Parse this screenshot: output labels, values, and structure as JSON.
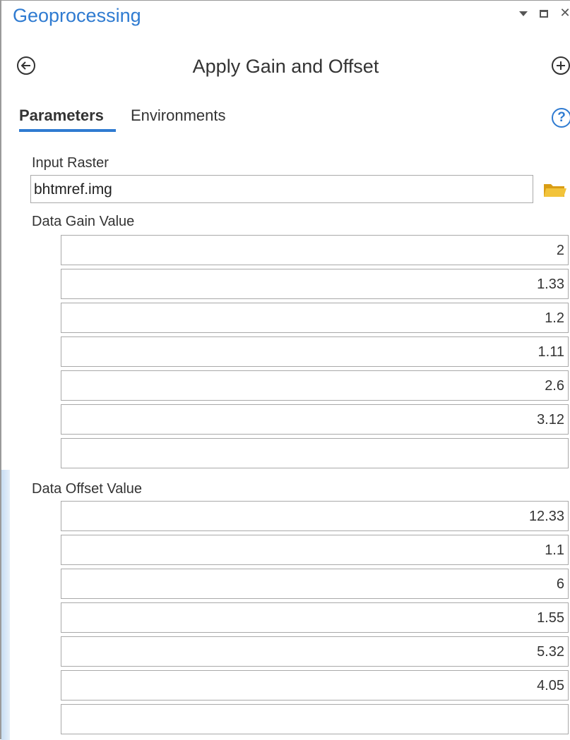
{
  "window": {
    "title": "Geoprocessing",
    "pin_icon": "dropdown-triangle-icon",
    "max_icon": "maximize-icon",
    "close_glyph": "✕"
  },
  "tool": {
    "title": "Apply Gain and Offset"
  },
  "tabs": [
    {
      "label": "Parameters",
      "active": true
    },
    {
      "label": "Environments",
      "active": false
    }
  ],
  "help_glyph": "?",
  "params": {
    "input_raster": {
      "label": "Input Raster",
      "value": "bhtmref.img"
    },
    "gain": {
      "label": "Data Gain Value",
      "values": [
        "2",
        "1.33",
        "1.2",
        "1.11",
        "2.6",
        "3.12",
        ""
      ]
    },
    "offset": {
      "label": "Data Offset Value",
      "values": [
        "12.33",
        "1.1",
        "6",
        "1.55",
        "5.32",
        "4.05",
        ""
      ]
    }
  },
  "colors": {
    "accent": "#2f7bd1",
    "folder": "#e8b820"
  }
}
